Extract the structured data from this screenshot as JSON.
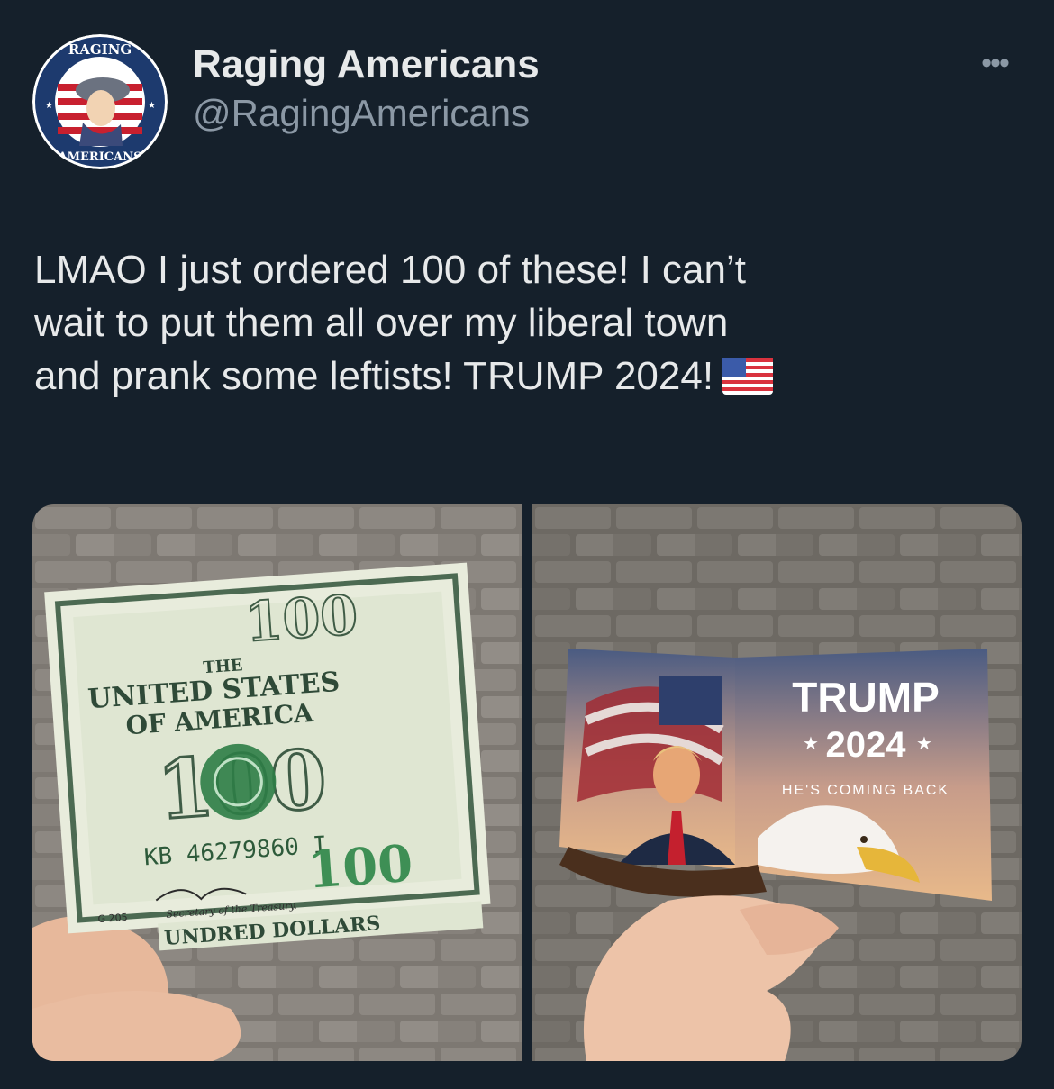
{
  "tweet": {
    "author": {
      "display_name": "Raging Americans",
      "handle": "@RagingAmericans",
      "avatar_text_top": "RAGING",
      "avatar_text_bottom": "AMERICANS"
    },
    "more_icon": "more-horizontal-icon",
    "text": "LMAO I just ordered 100 of these! I can’t\nwait to put them all over my liberal town\nand prank some leftists! TRUMP 2024!",
    "emoji": "us-flag-emoji",
    "media": [
      {
        "description_icon": "hundred-dollar-bill-photo",
        "bill": {
          "denomination": "100",
          "serial": "KB 46279860 I",
          "the": "THE",
          "united_states": "UNITED STATES",
          "of_america": "OF AMERICA",
          "secretary": "Secretary of the Treasury.",
          "dollars": "UNDRED DOLLARS",
          "plate": "G 205"
        }
      },
      {
        "description_icon": "trump-card-photo",
        "card": {
          "title": "TRUMP",
          "year": "2024",
          "tagline": "HE'S COMING BACK"
        }
      }
    ]
  },
  "colors": {
    "background": "#15202b",
    "primary_text": "#e7e9ea",
    "secondary_text": "#8b98a5",
    "bill_green": "#2d7d46"
  }
}
